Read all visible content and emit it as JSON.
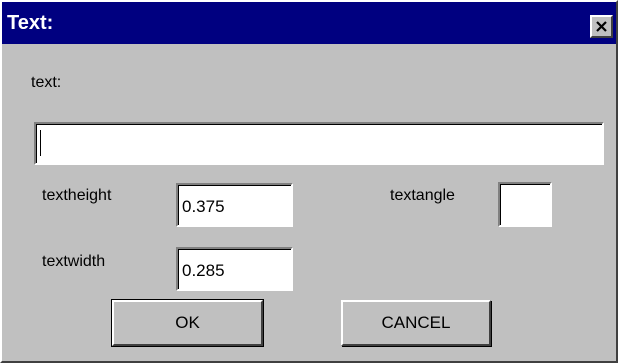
{
  "window": {
    "title": "Text:",
    "close_glyph": "✕",
    "close_icon": "close-icon"
  },
  "form": {
    "text_label": "text:",
    "text_value": "",
    "textheight_label": "textheight",
    "textheight_value": "0.375",
    "textwidth_label": "textwidth",
    "textwidth_value": "0.285",
    "textangle_label": "textangle",
    "textangle_value": ""
  },
  "buttons": {
    "ok_label": "OK",
    "cancel_label": "CANCEL"
  },
  "colors": {
    "titlebar": "#000080",
    "dialog_face": "#c0c0c0",
    "field_background": "#ffffff"
  }
}
